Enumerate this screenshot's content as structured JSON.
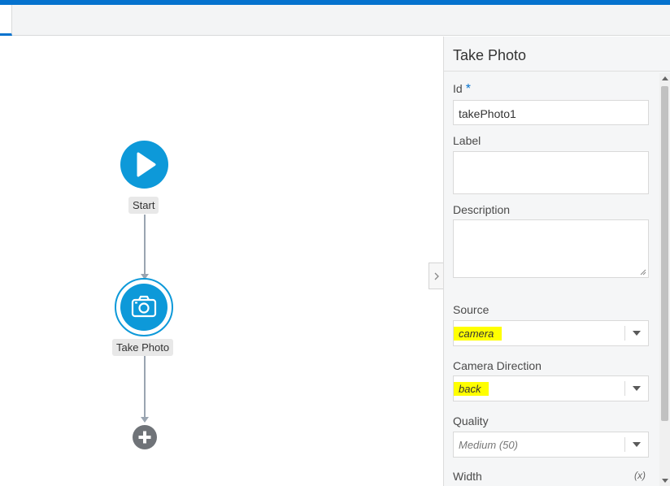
{
  "app": {
    "accent_color": "#0572ce",
    "node_color": "#0d99d9"
  },
  "canvas": {
    "start_node": {
      "label": "Start",
      "icon": "play-icon"
    },
    "take_photo_node": {
      "label": "Take Photo",
      "icon": "camera-icon",
      "selected": true
    },
    "add_node": {
      "icon": "plus-icon"
    }
  },
  "panel": {
    "title": "Take Photo",
    "fields": {
      "id": {
        "label": "Id",
        "required_marker": "*",
        "value": "takePhoto1"
      },
      "label": {
        "label": "Label",
        "value": ""
      },
      "description": {
        "label": "Description",
        "value": ""
      },
      "source": {
        "label": "Source",
        "value": "camera",
        "highlight_color": "#ffff00"
      },
      "camera_direction": {
        "label": "Camera Direction",
        "value": "back",
        "highlight_color": "#ffff00"
      },
      "quality": {
        "label": "Quality",
        "value": "Medium (50)"
      },
      "width": {
        "label": "Width",
        "expression_marker": "(x)"
      }
    }
  }
}
